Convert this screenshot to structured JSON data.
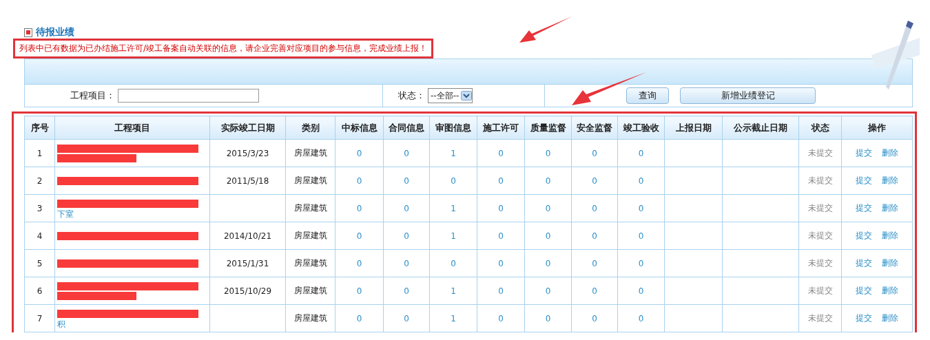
{
  "section_title": "待报业绩",
  "notice": {
    "text": "列表中已有数据为已办结施工许可/竣工备案自动关联的信息，请企业完善对应项目的参与信息，完成业绩上报！",
    "highlighted": true
  },
  "filters": {
    "project_label": "工程项目：",
    "status_label": "状态：",
    "status_value": "--全部--",
    "buttons": [
      "查询",
      "新增业绩登记"
    ]
  },
  "table": {
    "highlighted": true,
    "columns": [
      "序号",
      "工程项目",
      "实际竣工日期",
      "类别",
      "中标信息",
      "合同信息",
      "审图信息",
      "施工许可",
      "质量监督",
      "安全监督",
      "竣工验收",
      "上报日期",
      "公示截止日期",
      "状态",
      "操作"
    ],
    "rows": [
      {
        "no": "1",
        "project": {
          "redacted": true,
          "wrapped": true
        },
        "date": "2015/3/23",
        "category": "房屋建筑",
        "counts": [
          "0",
          "0",
          "1",
          "0",
          "0",
          "0",
          "0"
        ],
        "status": "未提交",
        "actions": [
          "提交",
          "删除"
        ]
      },
      {
        "no": "2",
        "project": {
          "redacted": true,
          "wrapped": false
        },
        "date": "2011/5/18",
        "category": "房屋建筑",
        "counts": [
          "0",
          "0",
          "0",
          "0",
          "0",
          "0",
          "0"
        ],
        "status": "未提交",
        "actions": [
          "提交",
          "删除"
        ]
      },
      {
        "no": "3",
        "project": {
          "redacted": true,
          "wrapped": true,
          "text": "下室"
        },
        "category": "房屋建筑",
        "counts": [
          "0",
          "0",
          "1",
          "0",
          "0",
          "0",
          "0"
        ],
        "status": "未提交",
        "actions": [
          "提交",
          "删除"
        ]
      },
      {
        "no": "4",
        "project": {
          "redacted": true,
          "wrapped": false
        },
        "date": "2014/10/21",
        "category": "房屋建筑",
        "counts": [
          "0",
          "0",
          "1",
          "0",
          "0",
          "0",
          "0"
        ],
        "status": "未提交",
        "actions": [
          "提交",
          "删除"
        ]
      },
      {
        "no": "5",
        "project": {
          "redacted": true,
          "wrapped": false
        },
        "date": "2015/1/31",
        "category": "房屋建筑",
        "counts": [
          "0",
          "0",
          "0",
          "0",
          "0",
          "0",
          "0"
        ],
        "status": "未提交",
        "actions": [
          "提交",
          "删除"
        ]
      },
      {
        "no": "6",
        "project": {
          "redacted": true,
          "wrapped": true
        },
        "date": "2015/10/29",
        "category": "房屋建筑",
        "counts": [
          "0",
          "0",
          "1",
          "0",
          "0",
          "0",
          "0"
        ],
        "status": "未提交",
        "actions": [
          "提交",
          "删除"
        ]
      },
      {
        "no": "7",
        "project": {
          "redacted": true,
          "wrapped": true,
          "text": "积"
        },
        "category": "房屋建筑",
        "counts": [
          "0",
          "0",
          "1",
          "0",
          "0",
          "0",
          "0"
        ],
        "status": "未提交",
        "actions": [
          "提交",
          "删除"
        ]
      }
    ]
  }
}
